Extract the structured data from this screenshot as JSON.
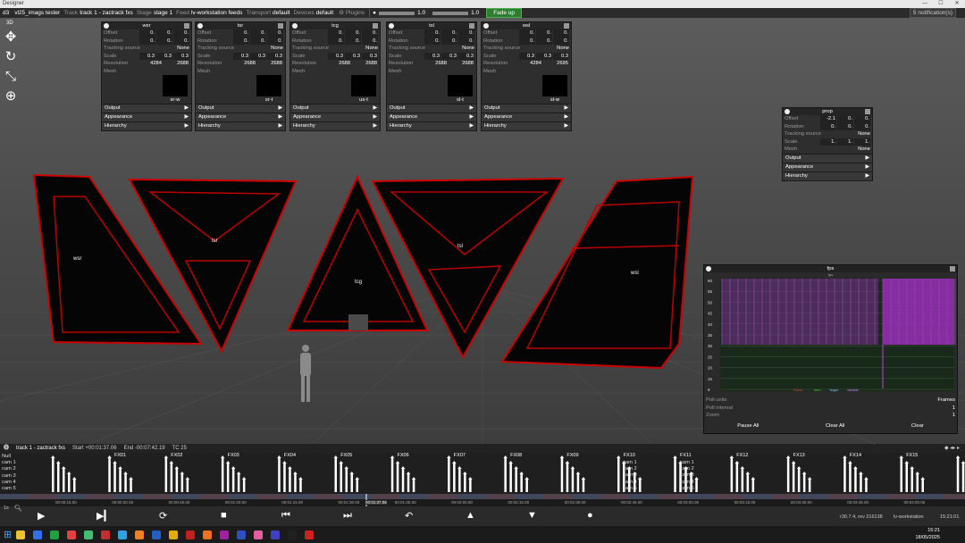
{
  "titlebar": {
    "title": "Designer"
  },
  "menubar": {
    "app": "d3",
    "project": "vl25_imags tester",
    "track_label": "Track",
    "track_value": "track 1 - zactrack fxs",
    "stage_label": "Stage",
    "stage_value": "stage 1",
    "feed_label": "Feed",
    "feed_value": "lv-workstation feeds",
    "transport_label": "Transport",
    "transport_value": "default",
    "devices_label": "Devices",
    "devices_value": "default",
    "plugins_label": "Plugins",
    "volume_value": "1.0",
    "fade_value": "1.0",
    "fadeup_label": "Fade up",
    "notifications": "5 notification(s)"
  },
  "toolbar": {
    "view_label": "3D"
  },
  "screen_panels": [
    {
      "name": "wsr",
      "offset": [
        "0.",
        "0.",
        "0."
      ],
      "rotation": [
        "0.",
        "0.",
        "0."
      ],
      "tracking": "None",
      "scale": [
        "0.3",
        "0.3",
        "0.3"
      ],
      "resolution": [
        "4284",
        "2688"
      ],
      "mesh": "sr-w"
    },
    {
      "name": "tsr",
      "offset": [
        "0.",
        "0.",
        "0."
      ],
      "rotation": [
        "0.",
        "0.",
        "0."
      ],
      "tracking": "None",
      "scale": [
        "0.3",
        "0.3",
        "0.3"
      ],
      "resolution": [
        "2688",
        "2688"
      ],
      "mesh": "sr-t"
    },
    {
      "name": "tcg",
      "offset": [
        "0.",
        "0.",
        "0."
      ],
      "rotation": [
        "0.",
        "0.",
        "0."
      ],
      "tracking": "None",
      "scale": [
        "0.3",
        "0.3",
        "0.3"
      ],
      "resolution": [
        "2688",
        "2688"
      ],
      "mesh": "us-t"
    },
    {
      "name": "tsl",
      "offset": [
        "0.",
        "0.",
        "0."
      ],
      "rotation": [
        "0.",
        "0.",
        "0."
      ],
      "tracking": "None",
      "scale": [
        "0.3",
        "0.3",
        "0.3"
      ],
      "resolution": [
        "2688",
        "2688"
      ],
      "mesh": "sl-t"
    },
    {
      "name": "wsl",
      "offset": [
        "0.",
        "0.",
        "0."
      ],
      "rotation": [
        "0.",
        "0.",
        "0."
      ],
      "tracking": "None",
      "scale": [
        "0.3",
        "0.3",
        "0.3"
      ],
      "resolution": [
        "4284",
        "2695"
      ],
      "mesh": "sl-w"
    }
  ],
  "panel_labels": {
    "offset": "Offset",
    "rotation": "Rotation",
    "tracking": "Tracking source",
    "scale": "Scale",
    "resolution": "Resolution",
    "mesh": "Mesh",
    "output": "Output",
    "appearance": "Appearance",
    "hierarchy": "Hierarchy"
  },
  "prop_panel": {
    "name": "prop",
    "offset": [
      "-2.1",
      "0.",
      "0."
    ],
    "rotation": [
      "0.",
      "0.",
      "0."
    ],
    "tracking": "None",
    "scale": [
      "1.",
      "1.",
      "1."
    ],
    "mesh": "None"
  },
  "scene_labels": [
    "wsr",
    "tsr",
    "tcg",
    "tsl",
    "wsl"
  ],
  "fps_panel": {
    "title": "fps",
    "subtitle": "fps",
    "y_ticks": [
      "60",
      "55",
      "50",
      "45",
      "40",
      "35",
      "30",
      "25",
      "20",
      "15",
      "9"
    ],
    "legend": [
      "Frame",
      "fixed",
      "Target",
      "Variable"
    ],
    "poll_units_label": "Poll units",
    "poll_units_value": "Frames",
    "poll_interval_label": "Poll interval",
    "poll_interval_value": "1",
    "zoom_label": "Zoom",
    "zoom_value": "1",
    "pause_label": "Pause All",
    "clearall_label": "Clear All",
    "clear_label": "Clear"
  },
  "timeline": {
    "track": "track 1 - zactrack fxs",
    "start": "Start +00:01:37.06",
    "end": "End -00:07:42.19",
    "tc": "TC 25",
    "track_labels": [
      "Null",
      "cam 1",
      "cam 2",
      "cam 3",
      "cam 4",
      "cam 5"
    ],
    "fx_labels": [
      "FX01",
      "FX02",
      "FX03",
      "FX04",
      "FX05",
      "FX06",
      "FX07",
      "FX08",
      "FX09",
      "FX10",
      "FX11",
      "FX12",
      "FX13",
      "FX14",
      "FX15"
    ],
    "repeat_labels": [
      "cam 1",
      "cam 2",
      "cam 3",
      "cam 4",
      "cam 5"
    ],
    "ruler_ticks": [
      "00:00:15.00",
      "00:00:30.00",
      "00:00:45.00",
      "00:01:00.00",
      "00:01:15.00",
      "00:01:30.00",
      "00:01:45.00",
      "00:02:00.00",
      "00:02:15.00",
      "00:02:30.00",
      "00:02:45.00",
      "00:03:00.00",
      "00:03:15.00",
      "00:03:30.00",
      "00:03:45.00",
      "00:04:00.00"
    ],
    "playhead": "00:01:37.06",
    "zoom_label": "1s",
    "version": "r30.7.4, rev 216138",
    "machine": "lv-workstation",
    "clock": "15:21:01"
  },
  "taskbar": {
    "time": "15:21",
    "date": "18/05/2025"
  }
}
